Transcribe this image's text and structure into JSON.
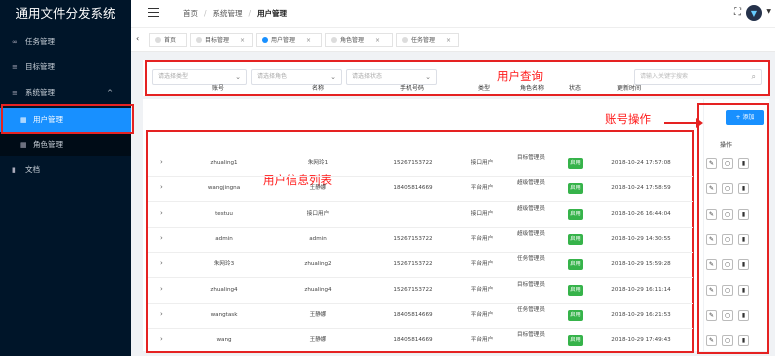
{
  "app": {
    "title": "通用文件分发系统"
  },
  "sidebar": {
    "items": [
      {
        "label": "任务管理",
        "icon": "infinity-icon"
      },
      {
        "label": "目标管理",
        "icon": "stack-icon"
      },
      {
        "label": "系统管理",
        "icon": "stack-icon",
        "caret": "^"
      },
      {
        "label": "用户管理",
        "icon": "grid-icon",
        "active": true
      },
      {
        "label": "角色管理",
        "icon": "grid-icon"
      },
      {
        "label": "文档",
        "icon": "book-icon"
      }
    ]
  },
  "header": {
    "breadcrumb": [
      "首页",
      "系统管理",
      "用户管理"
    ]
  },
  "tabs": [
    {
      "label": "首页",
      "closable": false
    },
    {
      "label": "目标管理",
      "closable": true
    },
    {
      "label": "用户管理",
      "closable": true,
      "active": true
    },
    {
      "label": "角色管理",
      "closable": true
    },
    {
      "label": "任务管理",
      "closable": true
    }
  ],
  "query": {
    "select_user_type": "请选择类型",
    "select_role": "请选择角色",
    "select_status": "请选择状态",
    "search_placeholder": "请输入关键字搜索"
  },
  "annotations": {
    "query_label": "用户查询",
    "account_ops_label": "账号操作",
    "table_label": "用户信息列表"
  },
  "toolbar": {
    "add_label": "+ 添加"
  },
  "table": {
    "columns": [
      "账号",
      "名称",
      "手机号码",
      "类型",
      "角色名称",
      "状态",
      "更新时间",
      "操作"
    ],
    "rows": [
      {
        "account": "zhualing1",
        "name": "朱网玲1",
        "phone": "15267153722",
        "type": "接口用户",
        "role": "目标管理员",
        "status": "启用",
        "updated": "2018-10-24 17:57:08"
      },
      {
        "account": "wangjingna",
        "name": "王静娜",
        "phone": "18405814669",
        "type": "平台用户",
        "role": "超级管理员",
        "status": "启用",
        "updated": "2018-10-24 17:58:59"
      },
      {
        "account": "testuu",
        "name": "接口用户",
        "phone": "",
        "type": "接口用户",
        "role": "超级管理员",
        "status": "启用",
        "updated": "2018-10-26 16:44:04"
      },
      {
        "account": "admin",
        "name": "admin",
        "phone": "15267153722",
        "type": "平台用户",
        "role": "超级管理员",
        "status": "启用",
        "updated": "2018-10-29 14:30:55"
      },
      {
        "account": "朱网玲3",
        "name": "zhualing2",
        "phone": "15267153722",
        "type": "平台用户",
        "role": "任务管理员",
        "status": "启用",
        "updated": "2018-10-29 15:59:28"
      },
      {
        "account": "zhualing4",
        "name": "zhualing4",
        "phone": "15267153722",
        "type": "平台用户",
        "role": "目标管理员",
        "status": "启用",
        "updated": "2018-10-29 16:11:14"
      },
      {
        "account": "wangtask",
        "name": "王静娜",
        "phone": "18405814669",
        "type": "平台用户",
        "role": "任务管理员",
        "status": "启用",
        "updated": "2018-10-29 16:21:53"
      },
      {
        "account": "wang",
        "name": "王静娜",
        "phone": "18405814669",
        "type": "平台用户",
        "role": "目标管理员",
        "status": "启用",
        "updated": "2018-10-29 17:49:43"
      }
    ]
  },
  "colors": {
    "sidebar_bg": "#001529",
    "accent": "#1890ff",
    "status_green": "#36b34a",
    "annotation_red": "#e52222"
  }
}
